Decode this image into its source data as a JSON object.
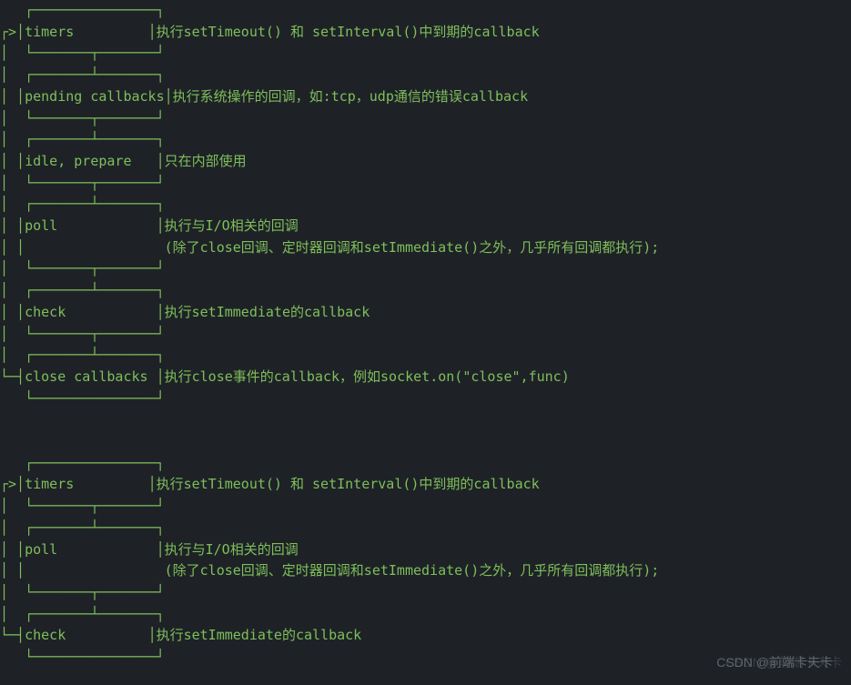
{
  "d1": {
    "r0": "   ┌───────────────┐",
    "r1_pre": "┌>│",
    "r1_label": "timers         ",
    "r1_desc": "执行setTimeout() 和 setInterval()中到期的callback",
    "r2": "│  └───────┬───────┘",
    "r3": "│  ┌───────┴───────┐",
    "r4_pre": "│ │",
    "r4_label": "pending callbacks",
    "r4_desc": "执行系统操作的回调，如:tcp，udp通信的错误callback",
    "r5": "│  └───────┬───────┘",
    "r6": "│  ┌───────┴───────┐",
    "r7_pre": "│ │",
    "r7_label": "idle, prepare   ",
    "r7_desc": "只在内部使用",
    "r8": "│  └───────┬───────┘",
    "r9": "│  ┌───────┴───────┐",
    "r10_pre": "│ │",
    "r10_label": "poll            ",
    "r10_desc": "执行与I/O相关的回调",
    "r11_pre": "│ │                ",
    "r11_desc": " (除了close回调、定时器回调和setImmediate()之外，几乎所有回调都执行);",
    "r12": "│  └───────┬───────┘",
    "r13": "│  ┌───────┴───────┐",
    "r14_pre": "│ │",
    "r14_label": "check           ",
    "r14_desc": "执行setImmediate的callback",
    "r15": "│  └───────┬───────┘",
    "r16": "│  ┌───────┴───────┐",
    "r17_pre": "└─┤",
    "r17_label": "close callbacks ",
    "r17_desc": "执行close事件的callback，例如socket.on(\"close\",func)",
    "r18": "   └───────────────┘"
  },
  "d2": {
    "r0": "   ┌───────────────┐",
    "r1_pre": "┌>│",
    "r1_label": "timers         ",
    "r1_desc": "执行setTimeout() 和 setInterval()中到期的callback",
    "r2": "│  └───────┬───────┘",
    "r3": "│  ┌───────┴───────┐",
    "r4_pre": "│ │",
    "r4_label": "poll            ",
    "r4_desc": "执行与I/O相关的回调",
    "r5_pre": "│ │                ",
    "r5_desc": " (除了close回调、定时器回调和setImmediate()之外，几乎所有回调都执行);",
    "r6": "│  └───────┬───────┘",
    "r7": "│  ┌───────┴───────┐",
    "r8_pre": "└─┤",
    "r8_label": "check          ",
    "r8_desc": "执行setImmediate的callback",
    "r9": "   └───────────────┘"
  },
  "watermark": "CSDN @前端卡夫卡"
}
